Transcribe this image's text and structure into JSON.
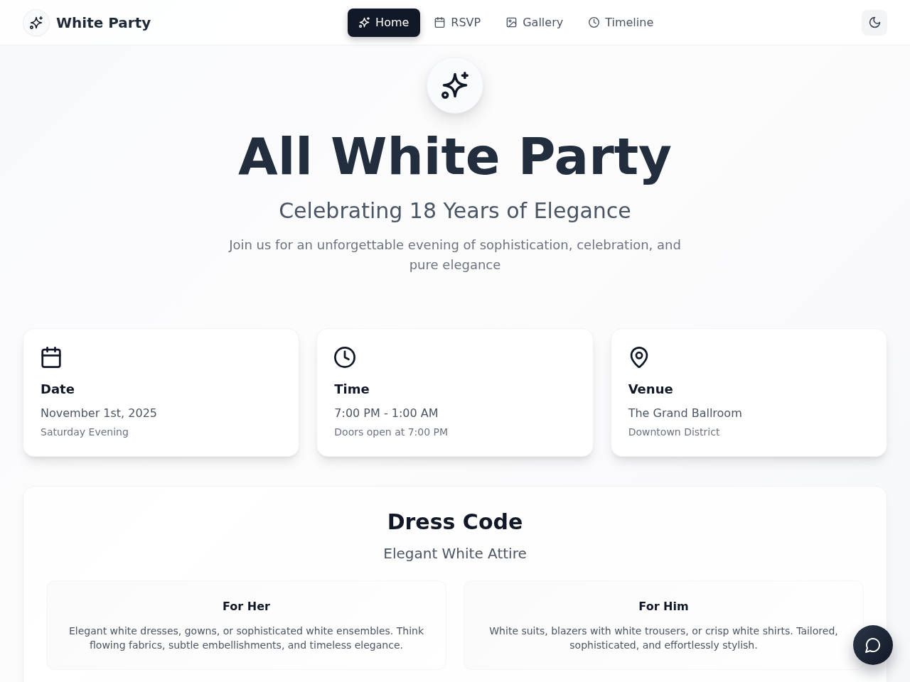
{
  "header": {
    "brand": "White Party",
    "nav": [
      {
        "label": "Home",
        "selected": true
      },
      {
        "label": "RSVP",
        "selected": false
      },
      {
        "label": "Gallery",
        "selected": false
      },
      {
        "label": "Timeline",
        "selected": false
      }
    ]
  },
  "hero": {
    "title": "All White Party",
    "subtitle": "Celebrating 18 Years of Elegance",
    "description": "Join us for an unforgettable evening of sophistication, celebration, and pure elegance"
  },
  "details": [
    {
      "title": "Date",
      "value": "November 1st, 2025",
      "note": "Saturday Evening"
    },
    {
      "title": "Time",
      "value": "7:00 PM - 1:00 AM",
      "note": "Doors open at 7:00 PM"
    },
    {
      "title": "Venue",
      "value": "The Grand Ballroom",
      "note": "Downtown District"
    }
  ],
  "dress_code": {
    "title": "Dress Code",
    "subtitle": "Elegant White Attire",
    "options": [
      {
        "title": "For Her",
        "description": "Elegant white dresses, gowns, or sophisticated white ensembles. Think flowing fabrics, subtle embellishments, and timeless elegance."
      },
      {
        "title": "For Him",
        "description": "White suits, blazers with white trousers, or crisp white shirts. Tailored, sophisticated, and effortlessly stylish."
      }
    ]
  }
}
